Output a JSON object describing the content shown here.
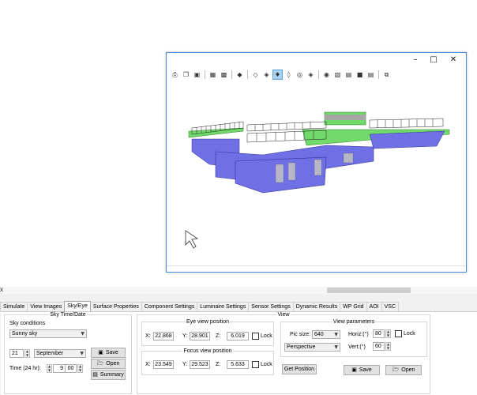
{
  "viewer": {
    "window_buttons": [
      "minimize-icon",
      "maximize-icon",
      "close-icon"
    ],
    "toolbar_icons": [
      "print-icon",
      "copy-icon",
      "save-icon",
      "camera-icon",
      "frame-icon",
      "shade-icon",
      "wire-icon",
      "view-icon",
      "solid-view-icon",
      "texture-icon",
      "render-icon",
      "sun-icon",
      "shadow-icon",
      "grid-icon",
      "axis-icon",
      "tag-icon",
      "window-icon"
    ],
    "active_toolbar_icon": "solid-view-icon",
    "colors": {
      "roof": "#72d96b",
      "walls": "#6f6fe6",
      "glass": "#a8a8c0",
      "accent": "#4d8fd4"
    }
  },
  "tabs": [
    "Simulate",
    "View Images",
    "Sky/Eye",
    "Surface Properties",
    "Component Settings",
    "Luminaire Settings",
    "Sensor Settings",
    "Dynamic Results",
    "WP Grid",
    "AOI",
    "VSC"
  ],
  "active_tab": "Sky/Eye",
  "sky": {
    "title": "Sky Time/Date",
    "conditions_label": "Sky conditions",
    "conditions_value": "Sunny sky",
    "day": "21",
    "month": "September",
    "time_label": "Time (24 hr):",
    "hour": "9",
    "minute": "00",
    "save": "Save",
    "open": "Open",
    "summary": "Summary"
  },
  "view": {
    "title": "View",
    "eye_title": "Eye view position",
    "focus_title": "Focus view position",
    "x_label": "X:",
    "y_label": "Y:",
    "z_label": "Z:",
    "eye": {
      "x": "22.868",
      "y": "28.901",
      "z": "6.019"
    },
    "focus": {
      "x": "23.549",
      "y": "29.523",
      "z": "5.633"
    },
    "lock": "Lock",
    "get_position": "Get Position",
    "params_title": "View parameters",
    "pic_size_label": "Pic size:",
    "pic_size": "640",
    "projection": "Perspective",
    "horiz_label": "Horiz:(°)",
    "horiz": "80",
    "vert_label": "Vert:(°)",
    "vert": "60",
    "save": "Save",
    "open": "Open"
  }
}
